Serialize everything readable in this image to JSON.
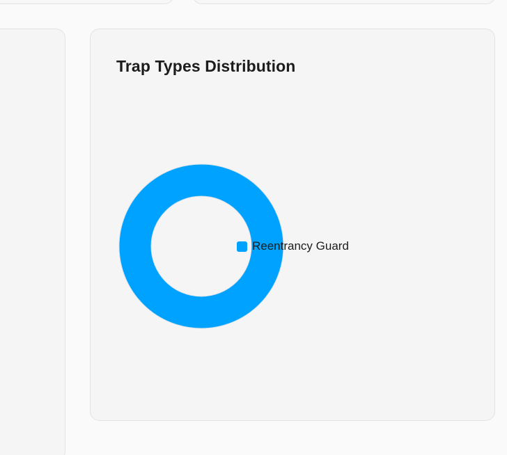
{
  "chart_data": {
    "type": "pie",
    "title": "Trap Types Distribution",
    "categories": [
      "Reentrancy Guard"
    ],
    "values": [
      1
    ],
    "colors": [
      "#00a2ff"
    ],
    "legend_position": "right"
  }
}
